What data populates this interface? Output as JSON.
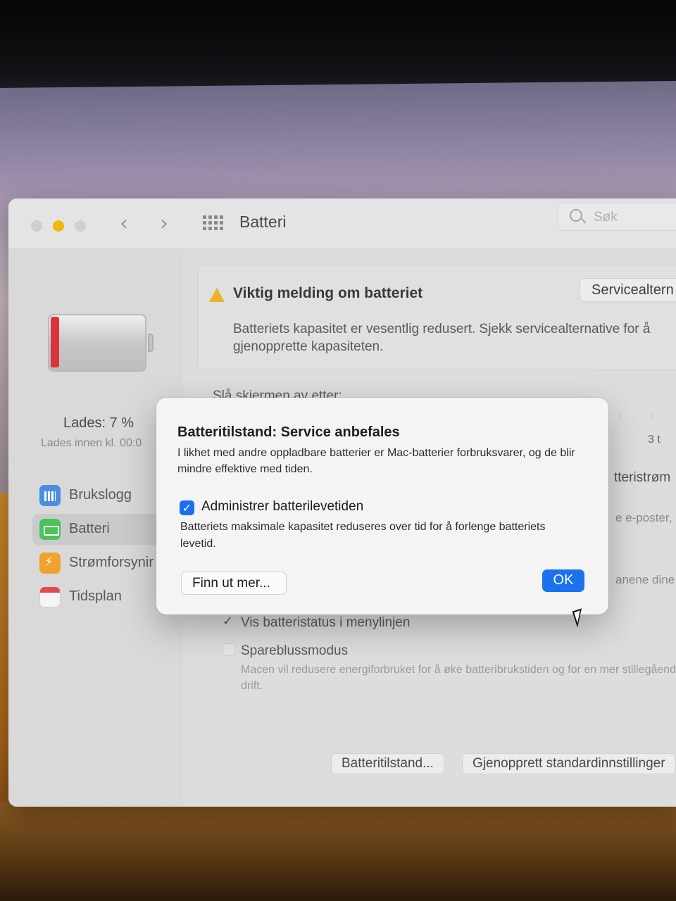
{
  "window": {
    "title": "Batteri"
  },
  "search": {
    "placeholder": "Søk"
  },
  "sidebar": {
    "charge_status": "Lades: 7 %",
    "charge_sub": "Lades innen kl. 00:0",
    "items": [
      {
        "label": "Brukslogg",
        "icon": "bar-chart-icon"
      },
      {
        "label": "Batteri",
        "icon": "battery-icon"
      },
      {
        "label": "Strømforsynir",
        "icon": "power-adapter-icon"
      },
      {
        "label": "Tidsplan",
        "icon": "calendar-icon"
      }
    ]
  },
  "notice": {
    "title": "Viktig melding om batteriet",
    "body": "Batteriets kapasitet er vesentlig redusert. Sjekk servicealternative for å gjenopprette kapasiteten.",
    "service_button": "Servicealtern"
  },
  "settings": {
    "screen_off_label": "Slå skiermen av etter:",
    "slider_label": "3 t",
    "frag_power": "tteristrøm",
    "frag_email": "e e-poster,",
    "frag_apps": "anene dine s",
    "show_status_label": "Vis batteristatus i menylinjen",
    "show_status_checked": true,
    "saver_label": "Spareblussmodus",
    "saver_checked": false,
    "saver_desc": "Macen vil redusere energiforbruket for å øke batteribrukstiden og for en mer stillegående drift.",
    "battery_health_button": "Batteritilstand...",
    "restore_defaults_button": "Gjenopprett standardinnstillinger"
  },
  "dialog": {
    "title": "Batteritilstand: Service anbefales",
    "body": "I likhet med andre oppladbare batterier er Mac-batterier forbruksvarer, og de blir mindre effektive med tiden.",
    "checkbox_label": "Administrer batterilevetiden",
    "checkbox_checked": true,
    "checkbox_desc": "Batteriets maksimale kapasitet reduseres over tid for å forlenge batteriets levetid.",
    "learn_more_button": "Finn ut mer...",
    "ok_button": "OK"
  },
  "colors": {
    "accent": "#1a72ee",
    "warning": "#e8b429",
    "battery_low": "#d9343a"
  }
}
